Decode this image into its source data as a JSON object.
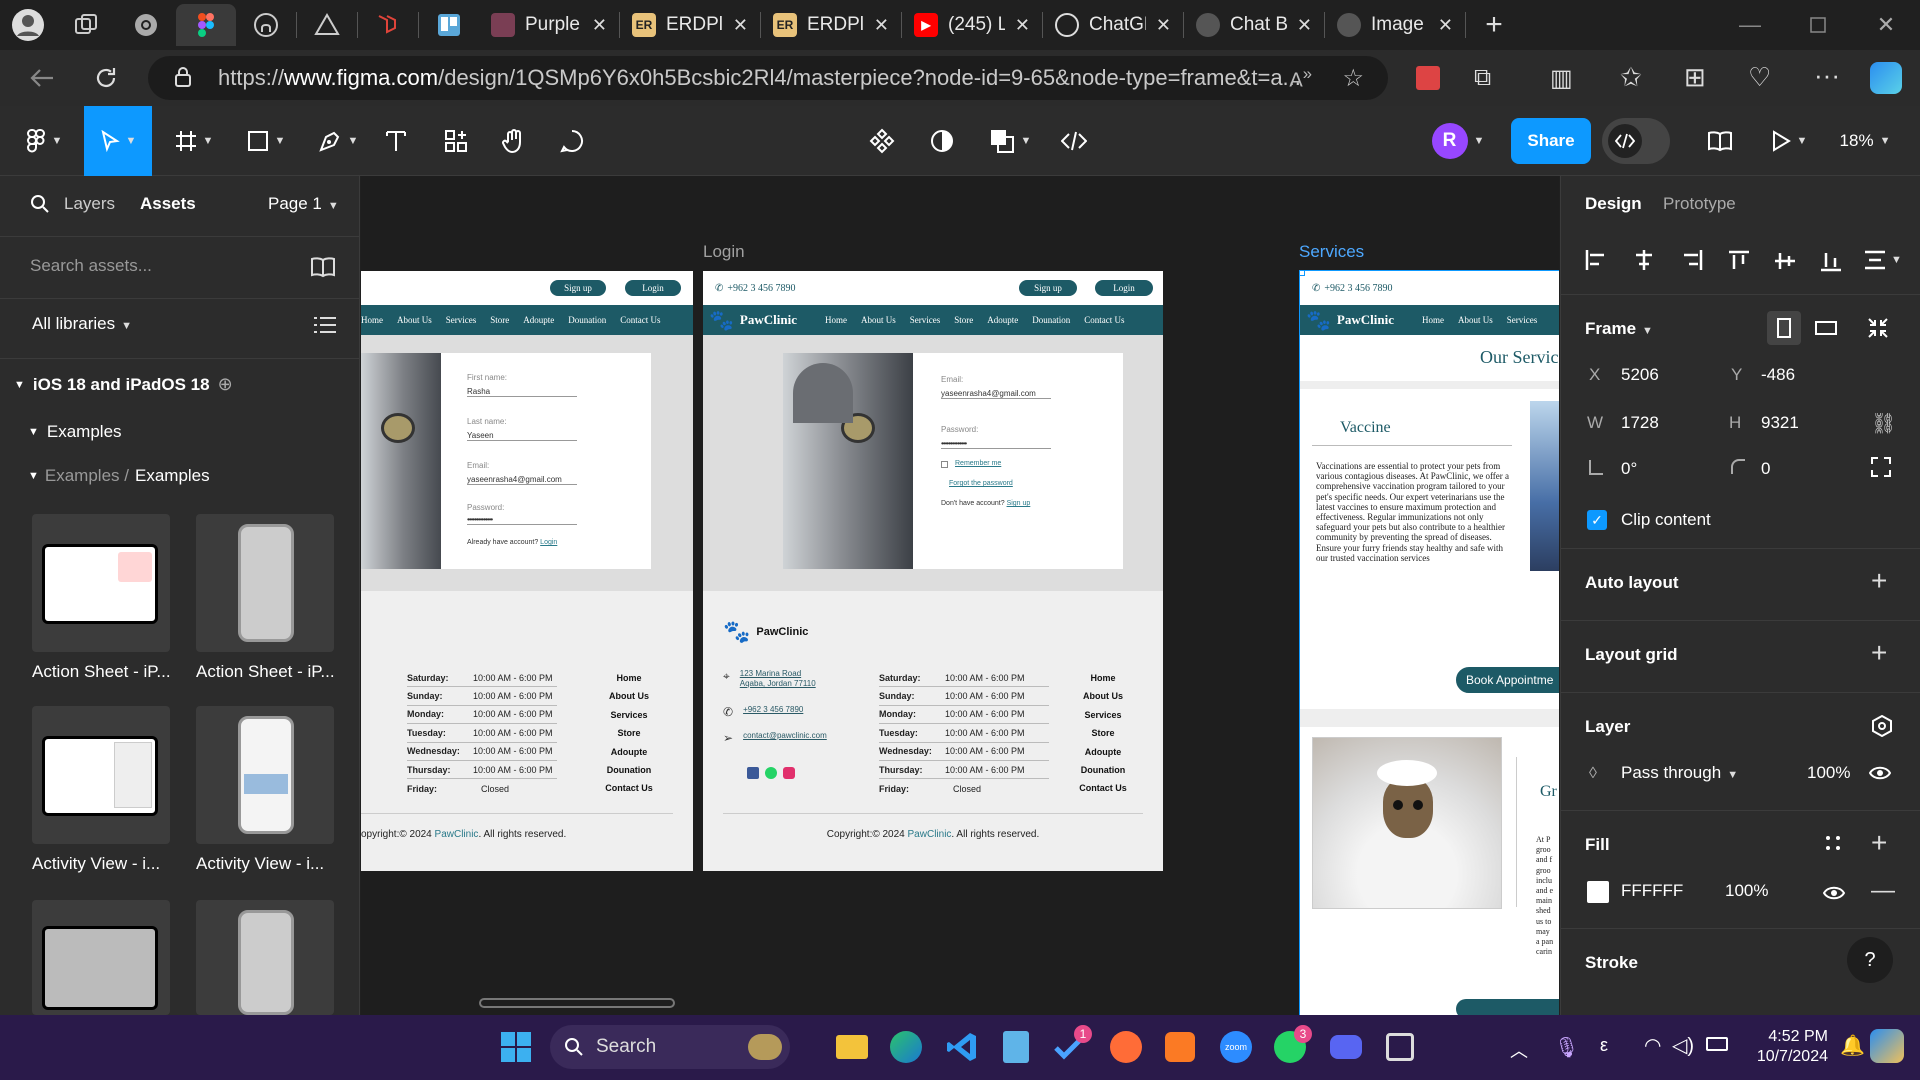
{
  "browser": {
    "tabs": [
      {
        "label": "",
        "icon": "workspaces-icon"
      },
      {
        "label": "",
        "icon": "chrome-icon"
      },
      {
        "label": "",
        "icon": "figma-icon",
        "active": true
      },
      {
        "label": "",
        "icon": "github-icon"
      },
      {
        "label": "",
        "icon": "vercel-icon"
      },
      {
        "label": "",
        "icon": "laravel-icon"
      },
      {
        "label": "",
        "icon": "trello-icon"
      },
      {
        "label": "Purple",
        "icon": "purple-icon"
      },
      {
        "label": "ERDPlu",
        "icon": "erdplus-icon"
      },
      {
        "label": "ERDPlu",
        "icon": "erdplus-icon"
      },
      {
        "label": "(245) L",
        "icon": "youtube-icon"
      },
      {
        "label": "ChatGP",
        "icon": "chatgpt-icon"
      },
      {
        "label": "Chat Bl",
        "icon": "chat-icon"
      },
      {
        "label": "Image",
        "icon": "image-icon"
      }
    ],
    "url_prefix": "https://",
    "url_domain": "www.figma.com",
    "url_path": "/design/1QSMp6Y6x0h5Bcsbic2Rl4/masterpiece?node-id=9-65&node-type=frame&t=a..."
  },
  "figma": {
    "share_label": "Share",
    "avatar_letter": "R",
    "zoom": "18%",
    "left_tabs": {
      "layers": "Layers",
      "assets": "Assets",
      "page": "Page 1"
    },
    "search_placeholder": "Search assets...",
    "libraries": "All libraries",
    "library_name": "iOS 18 and iPadOS 18",
    "group": "Examples",
    "breadcrumb_parent": "Examples /",
    "breadcrumb_current": "Examples",
    "assets": [
      "Action Sheet - iP...",
      "Action Sheet - iP...",
      "Activity View - i...",
      "Activity View - i...",
      "",
      ""
    ],
    "canvas": {
      "login_label": "Login",
      "services_label": "Services",
      "phone": "+962 3 456 7890",
      "brand": "PawClinic",
      "signup": "Sign up",
      "login": "Login",
      "nav": [
        "Home",
        "About Us",
        "Services",
        "Store",
        "Adoupte",
        "Dounation",
        "Contact Us"
      ],
      "signup_form": {
        "first_name_label": "First name:",
        "first_name": "Rasha",
        "last_name_label": "Last name:",
        "last_name": "Yaseen",
        "email_label": "Email:",
        "email": "yaseenrasha4@gmail.com",
        "password_label": "Password:",
        "password": "••••••••••••••",
        "footer_text": "Already have account?",
        "footer_link": "Login"
      },
      "login_form": {
        "email_label": "Email:",
        "email": "yaseenrasha4@gmail.com",
        "password_label": "Password:",
        "password": "••••••••••••••",
        "remember": "Remember me",
        "forgot": "Forgot the password",
        "no_account": "Don't have account?",
        "signup_link": "Sign up"
      },
      "address_line1": "123 Marina Road",
      "address_line2": "Aqaba, Jordan 77110",
      "email_contact": "contact@pawclinic.com",
      "hours": [
        {
          "day": "Saturday:",
          "time": "10:00 AM - 6:00 PM"
        },
        {
          "day": "Sunday:",
          "time": "10:00 AM - 6:00 PM"
        },
        {
          "day": "Monday:",
          "time": "10:00 AM - 6:00 PM"
        },
        {
          "day": "Tuesday:",
          "time": "10:00 AM - 6:00 PM"
        },
        {
          "day": "Wednesday:",
          "time": "10:00 AM - 6:00 PM"
        },
        {
          "day": "Thursday:",
          "time": "10:00 AM - 6:00 PM"
        },
        {
          "day": "Friday:",
          "time": "Closed"
        }
      ],
      "copyright_pre": "Copyright:© 2024 ",
      "copyright_brand": "PawClinic",
      "copyright_post": ". All rights reserved.",
      "copyright_pre_cut": "opyright:© 2024 ",
      "services_title": "Our Servic",
      "vaccine_title": "Vaccine",
      "vaccine_text": "Vaccinations are essential to protect your pets from various contagious diseases. At PawClinic, we offer a comprehensive vaccination program tailored to your pet's specific needs. Our expert veterinarians use the latest vaccines to ensure maximum protection and effectiveness. Regular immunizations not only safeguard your pets but also contribute to a healthier community by preventing the spread of diseases. Ensure your furry friends stay healthy and safe with our trusted vaccination services",
      "book_button": "Book Appointme",
      "grooming_title": "Gr",
      "grooming_text_lines": [
        "At P",
        "groo",
        "and f",
        "groo",
        "inclu",
        "and e",
        "main",
        "shed",
        "us to",
        "may",
        "a pan",
        "carin"
      ]
    },
    "design": {
      "tabs": {
        "design": "Design",
        "prototype": "Prototype"
      },
      "frame": "Frame",
      "x": "5206",
      "y": "-486",
      "w": "1728",
      "h": "9321",
      "rotation": "0°",
      "radius": "0",
      "clip_content": "Clip content",
      "auto_layout": "Auto layout",
      "layout_grid": "Layout grid",
      "layer": "Layer",
      "blend": "Pass through",
      "opacity": "100%",
      "fill": "Fill",
      "fill_hex": "FFFFFF",
      "fill_opacity": "100%",
      "stroke": "Stroke",
      "help": "?"
    }
  },
  "taskbar": {
    "search": "Search",
    "time": "4:52 PM",
    "date": "10/7/2024",
    "lang": "ε",
    "badges": {
      "todo": "1",
      "whatsapp": "3"
    }
  },
  "colors": {
    "accent": "#0d99ff",
    "clinic_teal": "#1d5a66",
    "link_teal": "#2a7a8a"
  }
}
